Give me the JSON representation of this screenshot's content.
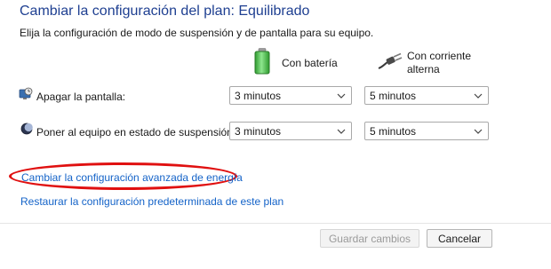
{
  "header": {
    "title": "Cambiar la configuración del plan: Equilibrado",
    "subtitle": "Elija la configuración de modo de suspensión y de pantalla para su equipo."
  },
  "columns": {
    "battery_label": "Con batería",
    "ac_label": "Con corriente alterna",
    "battery_icon": "battery-icon",
    "plug_icon": "power-plug-icon"
  },
  "rows": [
    {
      "label": "Apagar la pantalla:",
      "icon": "monitor-clock-icon",
      "battery_value": "3 minutos",
      "ac_value": "5 minutos"
    },
    {
      "label": "Poner al equipo en estado de suspensión:",
      "icon": "moon-sleep-icon",
      "battery_value": "3 minutos",
      "ac_value": "5 minutos"
    }
  ],
  "links": {
    "advanced": "Cambiar la configuración avanzada de energía",
    "restore": "Restaurar la configuración predeterminada de este plan"
  },
  "buttons": {
    "save": "Guardar cambios",
    "cancel": "Cancelar"
  },
  "colors": {
    "title": "#1e3f91",
    "link": "#1463c8",
    "highlight_ellipse": "#e01010",
    "battery_green": "#3fbf3f"
  }
}
